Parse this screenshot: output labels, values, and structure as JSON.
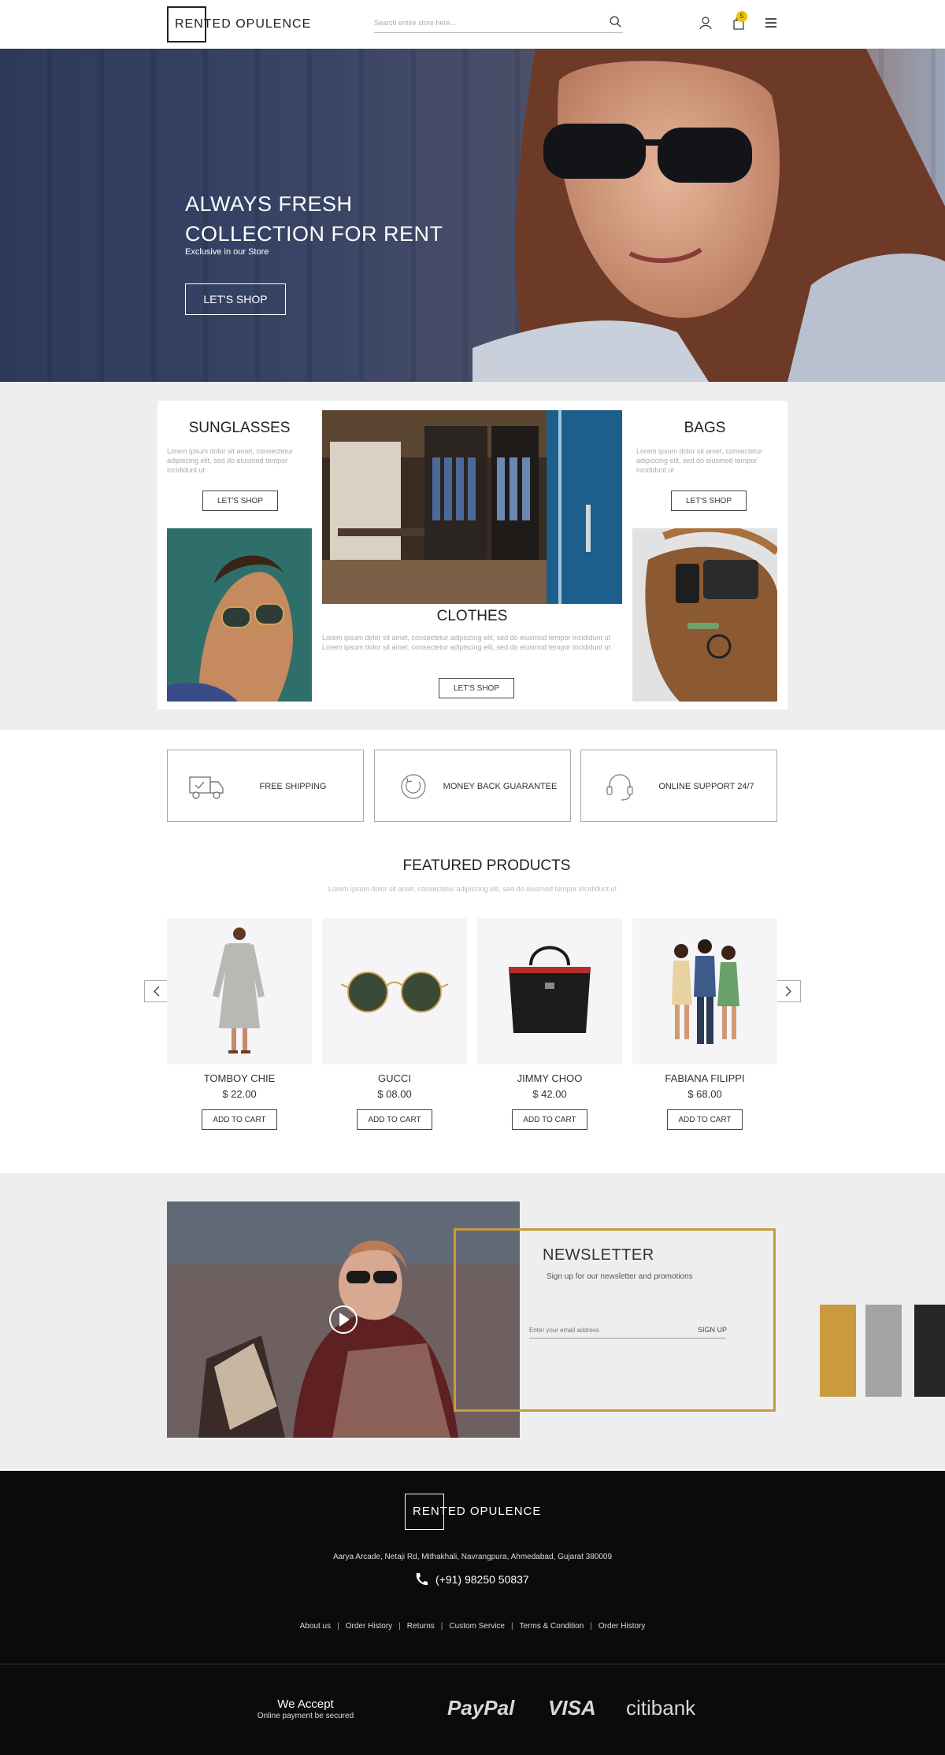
{
  "header": {
    "logo": "RENTED OPULENCE",
    "search_placeholder": "Search entire store here...",
    "cart_count": "5"
  },
  "hero": {
    "title_line1": "ALWAYS FRESH",
    "title_line2": "COLLECTION FOR RENT",
    "subtitle": "Exclusive in our Store",
    "button": "LET'S SHOP"
  },
  "categories": {
    "sunglasses": {
      "title": "SUNGLASSES",
      "text": "Lorem ipsum dolor sit amet, consectetur adipiscing elit, sed do eiusmod tempor incididunt ut",
      "button": "LET'S SHOP"
    },
    "bags": {
      "title": "BAGS",
      "text": "Lorem ipsum dolor sit amet, consectetur adipiscing elit, sed do eiusmod tempor incididunt ut",
      "button": "LET'S SHOP"
    },
    "clothes": {
      "title": "CLOTHES",
      "text": "Lorem ipsum dolor sit amet, consectetur adipiscing elit, sed do eiusmod tempor incididunt ut Lorem ipsum dolor sit amet, consectetur adipiscing elit, sed do eiusmod tempor incididunt ut",
      "button": "LET'S SHOP"
    }
  },
  "features": [
    {
      "label": "FREE SHIPPING",
      "icon": "truck-icon"
    },
    {
      "label": "MONEY BACK GUARANTEE",
      "icon": "refresh-icon"
    },
    {
      "label": "ONLINE SUPPORT 24/7",
      "icon": "headset-icon"
    }
  ],
  "featured": {
    "title": "FEATURED PRODUCTS",
    "subtitle": "Lorem ipsum dolor sit amet, consectetur adipiscing elit, sed do eiusmod tempor incididunt ut",
    "products": [
      {
        "name": "TOMBOY CHIE",
        "price": "$ 22.00",
        "button": "ADD TO CART"
      },
      {
        "name": "GUCCI",
        "price": "$ 08.00",
        "button": "ADD TO CART"
      },
      {
        "name": "JIMMY CHOO",
        "price": "$ 42.00",
        "button": "ADD TO CART"
      },
      {
        "name": "FABIANA FILIPPI",
        "price": "$ 68.00",
        "button": "ADD TO CART"
      }
    ]
  },
  "newsletter": {
    "title": "NEWSLETTER",
    "subtitle": "Sign up for our newsletter and promotions",
    "email_placeholder": "Enter your email address",
    "signup": "SIGN UP",
    "swatch_colors": [
      "#c99a3e",
      "#a3a3a3",
      "#262626"
    ]
  },
  "footer": {
    "logo": "RENTED OPULENCE",
    "address": "Aarya Arcade, Netaji Rd, Mithakhali, Navrangpura, Ahmedabad, Gujarat 380009",
    "phone": "(+91) 98250 50837",
    "links": [
      "About us",
      "Order History",
      "Returns",
      "Custom Service",
      "Terms & Condition",
      "Order History"
    ],
    "accept_title": "We Accept",
    "accept_sub": "Online payment be secured",
    "payments": [
      "PayPal",
      "VISA",
      "citibank"
    ]
  }
}
